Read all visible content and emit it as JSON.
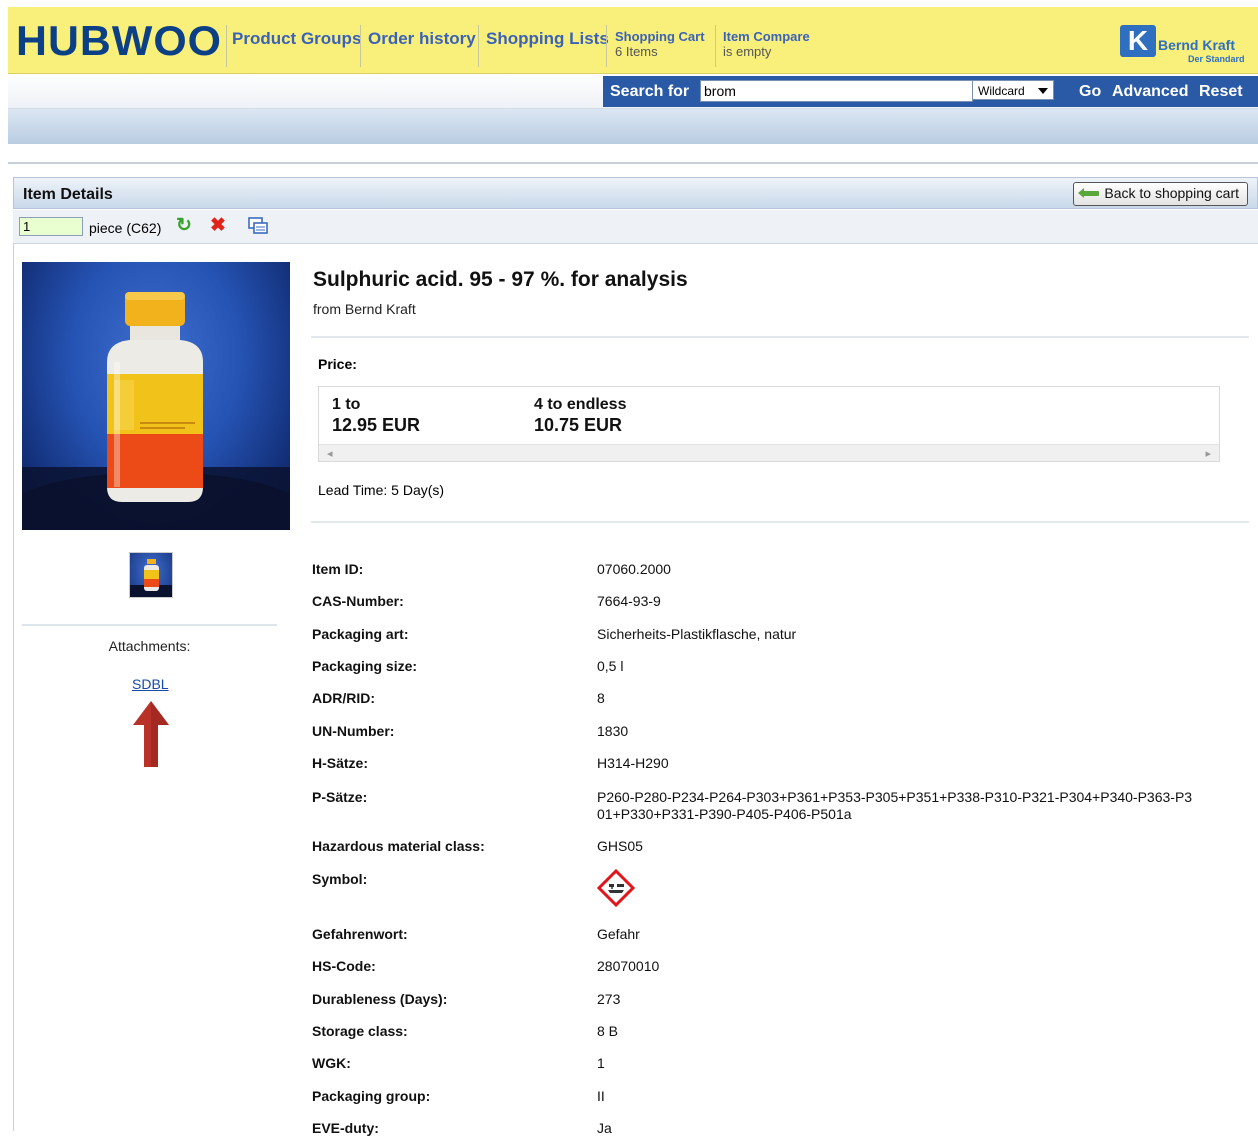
{
  "header": {
    "logo": "HUBWOO",
    "nav": [
      "Product Groups",
      "Order history",
      "Shopping Lists"
    ],
    "cart": {
      "label": "Shopping Cart",
      "sub": "6 Items"
    },
    "compare": {
      "label": "Item Compare",
      "sub": "is empty"
    },
    "brand": {
      "mark": "K",
      "name": "Bernd Kraft",
      "tagline": "Der Standard"
    }
  },
  "search": {
    "label": "Search for",
    "value": "brom",
    "mode": "Wildcard",
    "buttons": [
      "Go",
      "Advanced",
      "Reset"
    ]
  },
  "panel": {
    "title": "Item Details",
    "back_label": "Back to shopping cart",
    "quantity": "1",
    "unit": "piece (C62)"
  },
  "product": {
    "title": "Sulphuric acid. 95 - 97 %. for analysis",
    "vendor": "from Bernd Kraft",
    "price_label": "Price:",
    "price_tiers": [
      {
        "range": "1 to",
        "price": "12.95 EUR"
      },
      {
        "range": "4 to  endless",
        "price": "10.75 EUR"
      }
    ],
    "lead_time": "Lead Time: 5 Day(s)"
  },
  "attachments": {
    "label": "Attachments:",
    "link": "SDBL"
  },
  "attributes": [
    {
      "name": "Item ID:",
      "value": "07060.2000"
    },
    {
      "name": "CAS-Number:",
      "value": "7664-93-9"
    },
    {
      "name": "Packaging art:",
      "value": "Sicherheits-Plastikflasche, natur"
    },
    {
      "name": "Packaging size:",
      "value": "0,5 l"
    },
    {
      "name": "ADR/RID:",
      "value": "8"
    },
    {
      "name": "UN-Number:",
      "value": "1830"
    },
    {
      "name": "H-Sätze:",
      "value": "H314-H290"
    },
    {
      "name": "P-Sätze:",
      "value": "P260-P280-P234-P264-P303+P361+P353-P305+P351+P338-P310-P321-P304+P340-P363-P301+P330+P331-P390-P405-P406-P501a"
    },
    {
      "name": "Hazardous material class:",
      "value": "GHS05"
    },
    {
      "name": "Symbol:",
      "value": ""
    },
    {
      "name": "Gefahrenwort:",
      "value": "Gefahr"
    },
    {
      "name": "HS-Code:",
      "value": "28070010"
    },
    {
      "name": "Durableness (Days):",
      "value": "273"
    },
    {
      "name": "Storage class:",
      "value": "8 B"
    },
    {
      "name": "WGK:",
      "value": "1"
    },
    {
      "name": "Packaging group:",
      "value": "II"
    },
    {
      "name": "EVE-duty:",
      "value": "Ja"
    }
  ],
  "colors": {
    "header_bg": "#f8f07a",
    "brand_blue": "#0b3f86",
    "link_blue": "#3c62b8",
    "search_bar": "#2a5aa6",
    "red_arrow": "#b8322a"
  }
}
